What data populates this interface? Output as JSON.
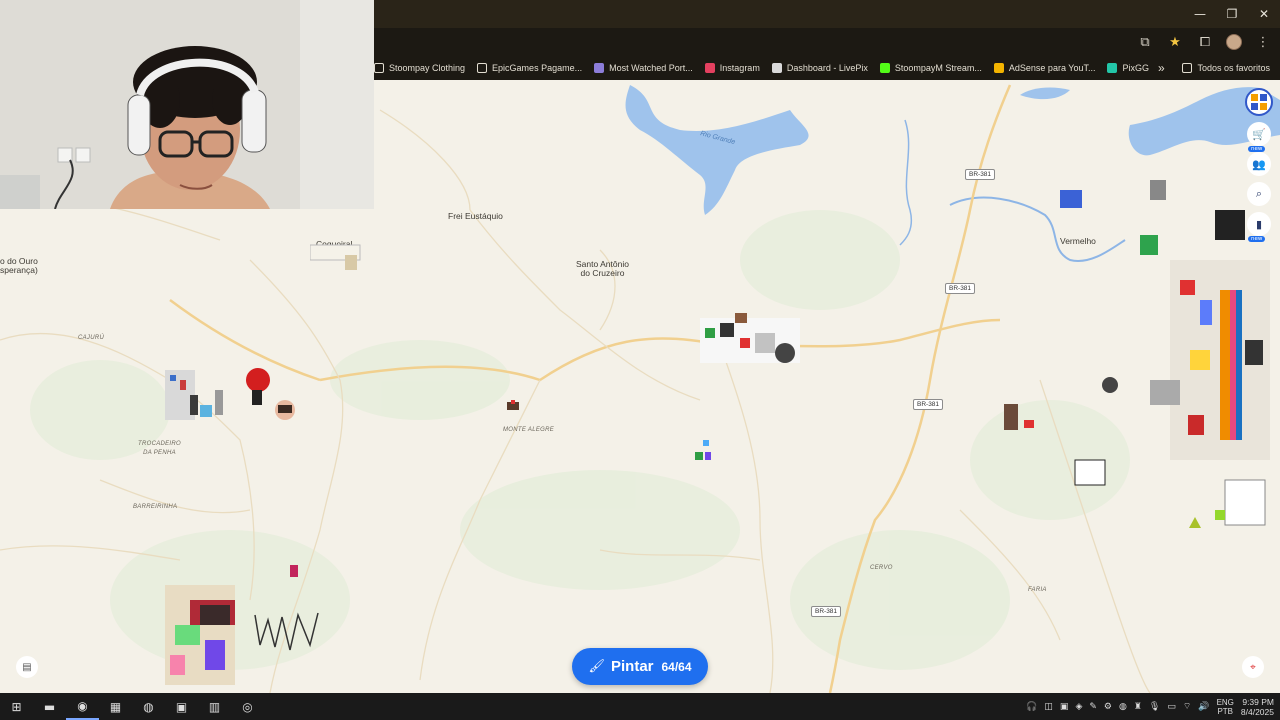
{
  "window_controls": {
    "minimize": "—",
    "restore": "❐",
    "close": "✕"
  },
  "bookmarks": [
    {
      "label": "Stoompay Clothing",
      "icon": "folder-icon",
      "color": "#e2ddd1"
    },
    {
      "label": "EpicGames Pagame...",
      "icon": "folder-icon",
      "color": "#e2ddd1"
    },
    {
      "label": "Most Watched Port...",
      "icon": "site-icon",
      "color": "#8c7dd9"
    },
    {
      "label": "Instagram",
      "icon": "instagram-icon",
      "color": "#e4405f"
    },
    {
      "label": "Dashboard - LivePix",
      "icon": "livepix-icon",
      "color": "#d9d9d9"
    },
    {
      "label": "StoompayM Stream...",
      "icon": "kick-icon",
      "color": "#53fc18"
    },
    {
      "label": "AdSense para YouT...",
      "icon": "adsense-icon",
      "color": "#f4b400"
    },
    {
      "label": "PixGG",
      "icon": "pixgg-icon",
      "color": "#23c6a8"
    }
  ],
  "bookmarks_more": "»",
  "all_bookmarks": "Todos os favoritos",
  "map": {
    "places": [
      {
        "name": "Frei Eustáquio"
      },
      {
        "name": "Santo Antônio\ndo Cruzeiro"
      },
      {
        "name": "Coqueiral"
      },
      {
        "name": "o do Ouro\nsperança)"
      },
      {
        "name": "Vermelho"
      }
    ],
    "districts": [
      "CAJURÚ",
      "TROCADEIRO\nDA PENHA",
      "BARREIRINHA",
      "MONTE ALEGRE",
      "CERVO",
      "FARIA"
    ],
    "roads": [
      "BR-381",
      "BR-381",
      "BR-381",
      "BR-381"
    ],
    "lake_label": "Rio Grande"
  },
  "pintar": {
    "label": "Pintar",
    "count": "64/64",
    "icon": "brush-icon"
  },
  "side_tools": [
    {
      "icon": "logo-icon"
    },
    {
      "icon": "cart-icon",
      "symbol": "🛒",
      "badge": "new"
    },
    {
      "icon": "users-icon",
      "symbol": "👥",
      "badge": ""
    },
    {
      "icon": "search-icon",
      "symbol": "⌕",
      "badge": ""
    },
    {
      "icon": "leaderboard-icon",
      "symbol": "▮",
      "badge": "new"
    }
  ],
  "bottom_left_tool": {
    "icon": "layers-icon",
    "symbol": "▤"
  },
  "bottom_right_tool": {
    "icon": "locate-icon",
    "symbol": "⌖"
  },
  "taskbar": {
    "apps": [
      {
        "icon": "windows-start-icon",
        "symbol": "⊞"
      },
      {
        "icon": "file-explorer-icon",
        "symbol": "▬"
      },
      {
        "icon": "chrome-icon",
        "symbol": "◉"
      },
      {
        "icon": "teams-icon",
        "symbol": "▦"
      },
      {
        "icon": "discord-icon",
        "symbol": "◍"
      },
      {
        "icon": "minecraft-icon",
        "symbol": "▣"
      },
      {
        "icon": "app-icon",
        "symbol": "▥"
      },
      {
        "icon": "obs-icon",
        "symbol": "◎"
      }
    ],
    "lang": {
      "top": "ENG",
      "bottom": "PTB"
    },
    "time": "9:39 PM",
    "date": "8/4/2025"
  }
}
